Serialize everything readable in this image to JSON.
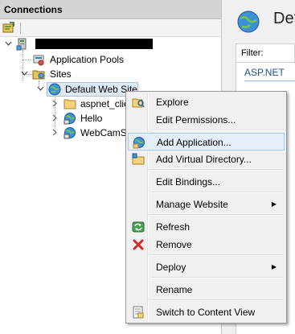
{
  "connections": {
    "title": "Connections",
    "tree": {
      "app_pools": "Application Pools",
      "sites": "Sites",
      "default_site": "Default Web Site",
      "aspnet_client": "aspnet_clie",
      "hello": "Hello",
      "webcamstream": "WebCamSt"
    }
  },
  "right_pane": {
    "title": "Def",
    "filter_label": "Filter:",
    "section": "ASP.NET"
  },
  "context_menu": {
    "items": [
      {
        "label": "Explore",
        "icon": "explore-icon"
      },
      {
        "label": "Edit Permissions..."
      },
      {
        "label": "Add Application...",
        "icon": "add-application-icon"
      },
      {
        "label": "Add Virtual Directory...",
        "icon": "add-virtual-directory-icon"
      },
      {
        "label": "Edit Bindings..."
      },
      {
        "label": "Manage Website",
        "submenu": true
      },
      {
        "label": "Refresh",
        "icon": "refresh-icon"
      },
      {
        "label": "Remove",
        "icon": "remove-icon"
      },
      {
        "label": "Deploy",
        "submenu": true
      },
      {
        "label": "Rename"
      },
      {
        "label": "Switch to Content View",
        "icon": "content-view-icon"
      }
    ],
    "submenu_arrow": "▶"
  },
  "colors": {
    "header_bg": "#d4d4d4",
    "selection_bg": "#dfe8f5",
    "menu_bg": "#f0f0f0",
    "highlight_bg": "#e5effa",
    "link_blue": "#1c4f9c"
  }
}
